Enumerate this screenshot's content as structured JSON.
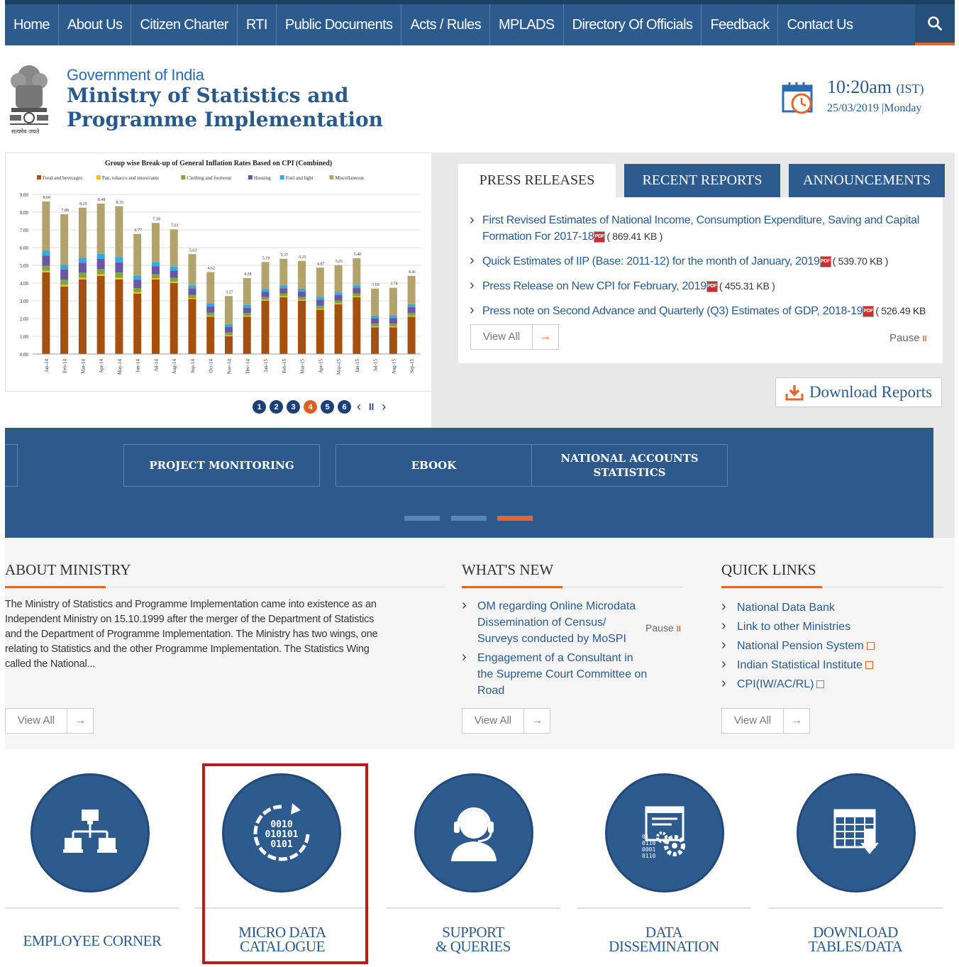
{
  "nav": {
    "items": [
      "Home",
      "About Us",
      "Citizen Charter",
      "RTI",
      "Public Documents",
      "Acts / Rules",
      "MPLADS",
      "Directory Of Officials",
      "Feedback",
      "Contact Us"
    ],
    "search_icon": "search-icon"
  },
  "header": {
    "emblem_caption": "सत्यमेव जयते",
    "gov_label": "Government of India",
    "ministry_line1": "Ministry of Statistics and",
    "ministry_line2": "Programme Implementation",
    "time": "10:20am",
    "tz": "(IST)",
    "date": "25/03/2019 |Monday"
  },
  "chart_data": {
    "type": "bar",
    "title": "Group wise Break-up of General Inflation Rates Based on CPI (Combined)",
    "legend": [
      "Food and beverages",
      "Pan, tobacco and intoxicants",
      "Clothing and footwear",
      "Housing",
      "Fuel and light",
      "Miscellaneous"
    ],
    "colors": [
      "#a4500f",
      "#f2c01e",
      "#7ea640",
      "#6b55a4",
      "#35a9e0",
      "#b1a36b"
    ],
    "yticks": [
      "9.00",
      "8.00",
      "7.00",
      "6.00",
      "5.00",
      "4.00",
      "3.00",
      "2.00",
      "1.00",
      "0.00"
    ],
    "ylim": [
      0,
      9
    ],
    "categories": [
      "Jan-14",
      "Feb-14",
      "Mar-14",
      "Apr-14",
      "May-14",
      "Jun-14",
      "Jul-14",
      "Aug-14",
      "Sep-14",
      "Oct-14",
      "Nov-14",
      "Dec-14",
      "Jan-15",
      "Feb-15",
      "Mar-15",
      "Apr-15",
      "May-15",
      "Jun-15",
      "Jul-15",
      "Aug-15",
      "Sep-15"
    ],
    "totals": [
      8.6,
      7.88,
      8.25,
      8.48,
      8.33,
      6.77,
      7.39,
      7.03,
      5.63,
      4.62,
      3.27,
      4.28,
      5.19,
      5.37,
      5.25,
      4.87,
      5.01,
      5.4,
      3.69,
      3.74,
      4.41
    ],
    "total_labels": [
      "8.60",
      "7.88",
      "8.25",
      "8.48",
      "8.33",
      "6.77",
      "7.39",
      "7.03",
      "5.63",
      "4.62",
      "3.27",
      "4.28",
      "5.19",
      "5.37",
      "5.25",
      "4.87",
      "5.01",
      "5.40",
      "3.69",
      "3.74",
      "4.41"
    ],
    "food": [
      4.6,
      3.8,
      4.2,
      4.4,
      4.2,
      3.4,
      4.2,
      4.0,
      3.1,
      2.1,
      1.0,
      2.1,
      3.0,
      3.2,
      3.0,
      2.5,
      2.8,
      3.2,
      1.5,
      1.5,
      2.1
    ]
  },
  "slider": {
    "dots": [
      "1",
      "2",
      "3",
      "4",
      "5",
      "6"
    ],
    "active": 3,
    "prev": "‹",
    "pause": "ll",
    "next": "›"
  },
  "press": {
    "tabs": [
      "PRESS RELEASES",
      "RECENT REPORTS",
      "ANNOUNCEMENTS"
    ],
    "items": [
      {
        "text": "First Revised Estimates of National Income, Consumption Expenditure, Saving and Capital Formation For 2017-18",
        "size": "( 869.41 KB )"
      },
      {
        "text": "Quick Estimates of IIP (Base: 2011-12) for the month of January, 2019",
        "size": "( 539.70 KB )"
      },
      {
        "text": "Press Release on New CPI for February, 2019",
        "size": "( 455.31 KB )"
      },
      {
        "text": "Press note on Second Advance and Quarterly (Q3) Estimates of GDP, 2018-19",
        "size": "( 526.49 KB )"
      }
    ],
    "pdf_label": "PDF",
    "view_all": "View All",
    "arrow": "→",
    "pause": "Pause",
    "pause_icon": "ll"
  },
  "download": {
    "label": "Download Reports",
    "icon": "download-icon"
  },
  "band": {
    "cards": [
      "PROJECT MONITORING",
      "EBOOK",
      "NATIONAL ACCOUNTS STATISTICS"
    ],
    "colors": {
      "bar_inactive": "#5b87b8",
      "bar_active": "#e8652a"
    }
  },
  "about": {
    "title": "ABOUT MINISTRY",
    "text": "The Ministry of Statistics and Programme Implementation came into existence as an Independent Ministry on 15.10.1999 after the merger of the Department of Statistics and the Department of Programme Implementation. The Ministry has two wings, one relating to Statistics and the other Programme Implementation. The Statistics Wing called the National...",
    "view_all": "View All"
  },
  "whatsnew": {
    "title": "WHAT'S NEW",
    "items": [
      "OM regarding Online Microdata Dissemination of Census/ Surveys conducted by MoSPI",
      "Engagement of a Consultant in the Supreme Court Committee on Road"
    ],
    "pause": "Pause",
    "view_all": "View All"
  },
  "quicklinks": {
    "title": "QUICK LINKS",
    "items": [
      "National Data Bank",
      "Link to other Ministries",
      "National Pension System",
      "Indian Statistical Institute",
      "CPI(IW/AC/RL)"
    ],
    "view_all": "View All"
  },
  "bottom": {
    "items": [
      {
        "label1": "EMPLOYEE CORNER",
        "label2": "",
        "icon": "network-icon"
      },
      {
        "label1": "MICRO DATA",
        "label2": "CATALOGUE",
        "icon": "binary-data-icon"
      },
      {
        "label1": "SUPPORT",
        "label2": "& QUERIES",
        "icon": "headset-user-icon"
      },
      {
        "label1": "DATA",
        "label2": "DISSEMINATION",
        "icon": "data-gears-icon"
      },
      {
        "label1": "DOWNLOAD",
        "label2": "TABLES/DATA",
        "icon": "table-download-icon"
      }
    ],
    "binary_lines": [
      "0010",
      "010101",
      "0101"
    ],
    "data_lines": [
      "01",
      "0110",
      "0001",
      "0110"
    ]
  },
  "colors": {
    "nav": "#2e5b8e",
    "accent": "#e8652a",
    "link": "#2a5a8c"
  }
}
